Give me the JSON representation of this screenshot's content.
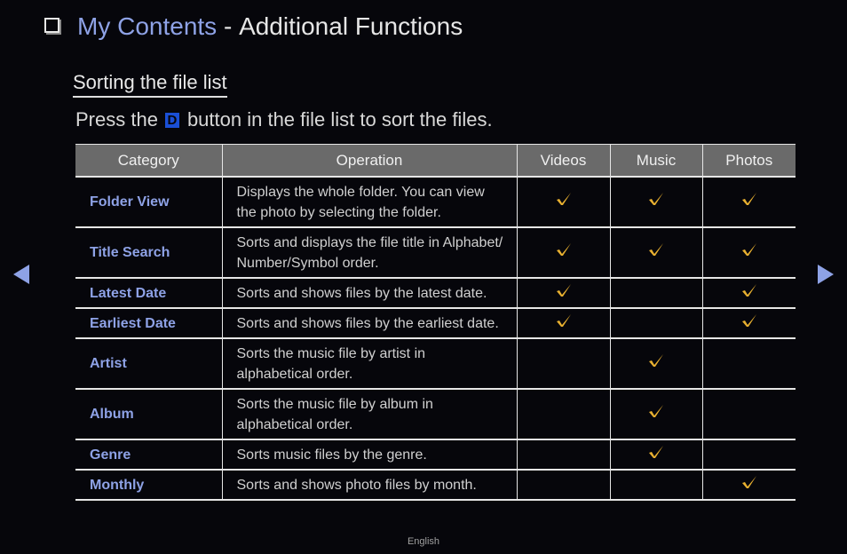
{
  "header": {
    "title_main": "My Contents",
    "title_separator": " - ",
    "title_rest": "Additional Functions"
  },
  "section": {
    "heading": "Sorting the file list",
    "instruction_before": "Press the",
    "button_key": "D",
    "button_key_color": "#1a4fd6",
    "instruction_after": "button in the file list to sort the files."
  },
  "table": {
    "columns": [
      "Category",
      "Operation",
      "Videos",
      "Music",
      "Photos"
    ],
    "rows": [
      {
        "category": "Folder View",
        "operation": [
          "Displays the whole folder. You can view",
          "the photo by selecting the folder."
        ],
        "videos": true,
        "music": true,
        "photos": true
      },
      {
        "category": "Title Search",
        "operation": [
          "Sorts and displays the file title in Alphabet/",
          "Number/Symbol order."
        ],
        "videos": true,
        "music": true,
        "photos": true
      },
      {
        "category": "Latest Date",
        "operation": [
          "Sorts and shows files by the latest date."
        ],
        "videos": true,
        "music": false,
        "photos": true
      },
      {
        "category": "Earliest Date",
        "operation": [
          "Sorts and shows files by the earliest date."
        ],
        "videos": true,
        "music": false,
        "photos": true
      },
      {
        "category": "Artist",
        "operation": [
          "Sorts the music file by artist in",
          "alphabetical order."
        ],
        "videos": false,
        "music": true,
        "photos": false
      },
      {
        "category": "Album",
        "operation": [
          "Sorts the music file by album in",
          "alphabetical order."
        ],
        "videos": false,
        "music": true,
        "photos": false
      },
      {
        "category": "Genre",
        "operation": [
          "Sorts music files by the genre."
        ],
        "videos": false,
        "music": true,
        "photos": false
      },
      {
        "category": "Monthly",
        "operation": [
          "Sorts and shows photo files by month."
        ],
        "videos": false,
        "music": false,
        "photos": true
      }
    ],
    "check_icon": "checkmark-icon",
    "check_color": "#e8b030",
    "category_color": "#8ea2e6",
    "header_bg": "#6a6a6a"
  },
  "navigation": {
    "prev_icon": "triangle-left-icon",
    "next_icon": "triangle-right-icon",
    "arrow_color": "#8ea2e6"
  },
  "footer": {
    "language": "English"
  }
}
